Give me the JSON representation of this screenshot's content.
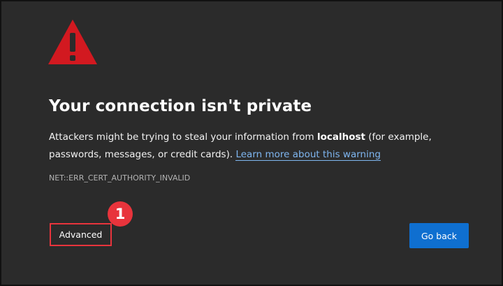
{
  "page": {
    "title": "Your connection isn't private",
    "message_prefix": "Attackers might be trying to steal your information from ",
    "host": "localhost",
    "message_suffix": " (for example, passwords, messages, or credit cards). ",
    "learn_more_link": "Learn more about this warning",
    "error_code": "NET::ERR_CERT_AUTHORITY_INVALID",
    "icon": "warning-triangle-icon"
  },
  "buttons": {
    "advanced": "Advanced",
    "go_back": "Go back"
  },
  "annotation": {
    "step_number": "1"
  },
  "colors": {
    "background": "#2b2b2b",
    "warning_red": "#d21920",
    "link_blue": "#7fb6f0",
    "primary_button": "#0f6fd0",
    "annotation_red": "#e8343c"
  }
}
